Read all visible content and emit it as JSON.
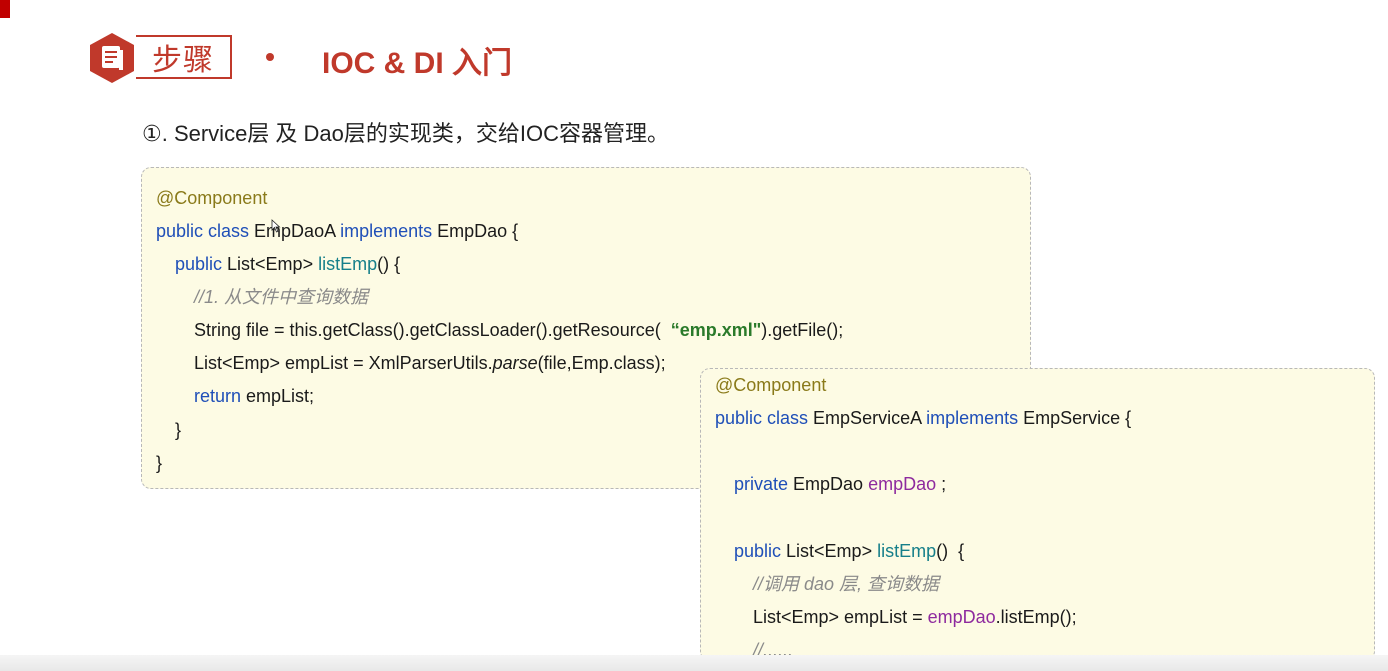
{
  "header": {
    "icon": "document-icon",
    "label": "步骤",
    "title": "IOC & DI 入门",
    "accent_color": "#c0392b"
  },
  "step": {
    "text": "①. Service层 及 Dao层的实现类，交给IOC容器管理。"
  },
  "panel_dao": {
    "annotation": "@Component",
    "line2": {
      "kw1": "public class",
      "cls": " EmpDaoA ",
      "kw2": "implements",
      "rest": " EmpDao {"
    },
    "line3": {
      "kw": "public",
      "type": " List<Emp> ",
      "fn": "listEmp",
      "rest": "() {"
    },
    "comment": "//1. 从文件中查询数据",
    "line5": {
      "pre": "String file = this.getClass().getClassLoader().getResource(  ",
      "str": "“emp.xml\"",
      "post": ").getFile();"
    },
    "line6": {
      "pre": "List<Emp> empList = XmlParserUtils.",
      "ital": "parse",
      "post": "(file,Emp.class);"
    },
    "line7": {
      "kw": "return",
      "rest": " empList;"
    },
    "close_inner": "}",
    "close_outer": "}"
  },
  "panel_service": {
    "annotation": "@Component",
    "line2": {
      "kw1": "public class",
      "cls": " EmpServiceA ",
      "kw2": "implements",
      "rest": " EmpService {"
    },
    "line4": {
      "kw": "private",
      "type": " EmpDao ",
      "fld": "empDao",
      "rest": " ;"
    },
    "line6": {
      "kw": "public",
      "type": " List<Emp> ",
      "fn": "listEmp",
      "rest": "()  {"
    },
    "comment": "//调用 dao 层, 查询数据",
    "line8": {
      "pre": "List<Emp> empList = ",
      "fld": "empDao",
      "post": ".listEmp();"
    },
    "comment2": "//......"
  },
  "colors": {
    "keyword": "#1f4fb8",
    "annotation": "#8a7a1a",
    "method": "#167f8a",
    "string": "#2a7a2a",
    "field": "#8e2a9e",
    "panel_bg": "#fdfbe4"
  }
}
